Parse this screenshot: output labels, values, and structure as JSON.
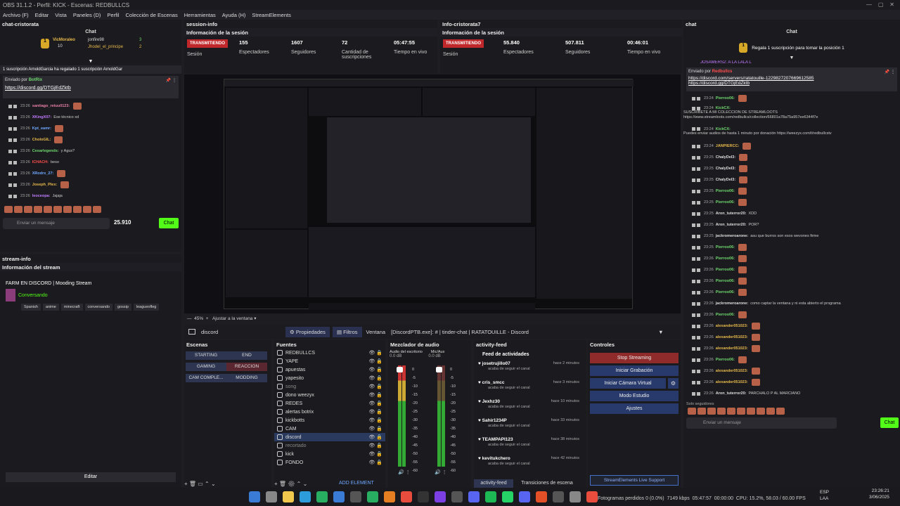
{
  "window": {
    "title": "OBS 31.1.2 - Perfil: KICK - Escenas: REDBULLCS"
  },
  "menu": [
    "Archivo (F)",
    "Editar",
    "Vista",
    "Paneles (D)",
    "Perfil",
    "Colección de Escenas",
    "Herramientas",
    "Ayuda (H)",
    "StreamElements"
  ],
  "chat_left": {
    "dock_title": "chat-cristorata",
    "tab": "Chat",
    "leader1": "VicMoraleo",
    "leader1_count": "10",
    "leader2": "jonfire98",
    "leader2_count": "3",
    "leader3": "Jhodel_el_principe",
    "leader3_count": "2",
    "banner": "1 suscripción  ArnoldGarcia ha regalado 1 suscripción  ArnoldGar",
    "pinned_by": "Enviado por",
    "pinned_user": "BotRix",
    "pinned_link": "https://discord.gg/DTGjEdZktb",
    "messages": [
      {
        "time": "23:26",
        "user": "santiago_retuu0123:",
        "text": "",
        "color": "#e67ea5"
      },
      {
        "time": "23:26",
        "user": "XKingX07:",
        "text": "Ese técnico xd",
        "color": "#c27bff"
      },
      {
        "time": "23:26",
        "user": "Kpt_eamr:",
        "text": "",
        "color": "#6fa8ff"
      },
      {
        "time": "23:26",
        "user": "CholoGIL:",
        "text": "",
        "color": "#e8b94b"
      },
      {
        "time": "23:26",
        "user": "Cesarlegends:",
        "text": "y Agus?",
        "color": "#6fd86f"
      },
      {
        "time": "23:26",
        "user": "ICHACH:",
        "text": "beso",
        "color": "#ff4d4d"
      },
      {
        "time": "23:26",
        "user": "XRodrx_27:",
        "text": "",
        "color": "#6fa8ff"
      },
      {
        "time": "23:26",
        "user": "Joseph_Plex:",
        "text": "",
        "color": "#e8b94b"
      },
      {
        "time": "23:26",
        "user": "leoceopa:",
        "text": "Jajaja",
        "color": "#c27bff"
      }
    ],
    "input_placeholder": "Enviar un mensaje",
    "points": "25.910",
    "send": "Chat"
  },
  "stream_info": {
    "dock_title": "stream-info",
    "section": "Información del stream",
    "title": "FARM EN DISCORD | Mooding Stream",
    "category": "Conversando",
    "tags": [
      "Spanish",
      "anime",
      "minecraft",
      "conversando",
      "gossip",
      "leagueofleg"
    ],
    "edit": "Editar"
  },
  "session_info": {
    "dock_title": "session-info",
    "section": "Información de la sesión",
    "status": "TRANSMITIENDO",
    "status_sub": "Sesión",
    "stats": [
      {
        "v": "155",
        "l": "Espectadores"
      },
      {
        "v": "1607",
        "l": "Seguidores"
      },
      {
        "v": "72",
        "l": "Cantidad de suscripciones"
      },
      {
        "v": "05:47:55",
        "l": "Tiempo en vivo"
      }
    ]
  },
  "info_cris": {
    "dock_title": "Info-cristorata7",
    "section": "Información de la sesión",
    "status": "TRANSMITIENDO",
    "status_sub": "Sesión",
    "stats": [
      {
        "v": "55.840",
        "l": "Espectadores"
      },
      {
        "v": "507.811",
        "l": "Seguidores"
      },
      {
        "v": "00:46:01",
        "l": "Tiempo en vivo"
      }
    ]
  },
  "preview": {
    "zoom": "45%",
    "fit": "Ajustar a la ventana",
    "source_name": "discord",
    "props": "Propiedades",
    "filters": "Filtros",
    "window_label": "Ventana",
    "window_value": "[DiscordPTB.exe]: # | tinder-chat | RATATOUILLE - Discord"
  },
  "scenes": {
    "title": "Escenas",
    "items": [
      "STARTING",
      "END",
      "GAMING",
      "REACCION",
      "CAM COMPLE...",
      "MODDING"
    ]
  },
  "sources": {
    "title": "Fuentes",
    "items": [
      "REDBULLCS",
      "YAPE",
      "apuestas",
      "yapesito",
      "song",
      "dono weezyx",
      "REDES",
      "alertas botrix",
      "kickbotts",
      "CAM",
      "discord",
      "recortado",
      "kick",
      "FONDO"
    ]
  },
  "mixer": {
    "title": "Mezclador de audio",
    "ch1": "Audio del escritorio",
    "ch2": "Mic/Aux",
    "db": "0.0 dB",
    "scale": [
      "0",
      "-5",
      "-10",
      "-15",
      "-20",
      "-25",
      "-30",
      "-35",
      "-40",
      "-45",
      "-50",
      "-55",
      "-60"
    ]
  },
  "feed": {
    "dock_title": "activity-feed",
    "header": "Feed de actividades",
    "items": [
      {
        "n": "josetrujillo07",
        "t": "hace 2 minutos",
        "s": "acaba de seguir el canal"
      },
      {
        "n": "cris_smcc",
        "t": "hace 3 minutos",
        "s": "acaba de seguir el canal"
      },
      {
        "n": "Jexhz30",
        "t": "hace 10 minutos",
        "s": "acaba de seguir el canal"
      },
      {
        "n": "Sahir1234P",
        "t": "hace 33 minutos",
        "s": "acaba de seguir el canal"
      },
      {
        "n": "TEAMPAPI123",
        "t": "hace 38 minutos",
        "s": "acaba de seguir el canal"
      },
      {
        "n": "kevitukchero",
        "t": "hace 42 minutos",
        "s": "acaba de seguir el canal"
      }
    ],
    "tab1": "activity-feed",
    "tab2": "Transiciones de escena",
    "add": "ADD ELEMENT"
  },
  "controls": {
    "title": "Controles",
    "stop": "Stop Streaming",
    "rec": "Iniciar Grabación",
    "vcam": "Iniciar Cámara Virtual",
    "studio": "Modo Estudio",
    "settings": "Ajustes",
    "se": "StreamElements Live Support"
  },
  "chat_right": {
    "dock_title": "chat",
    "tab": "Chat",
    "gift": "Regala 1 suscripción para tomar la posición 1",
    "banner": "JOSAMERS2: A LA LALA L",
    "pinned_by": "Enviado por",
    "pinned_user": "Redbullcs",
    "link1": "https://discord.com/servers/ratatouille-1229827207669612585",
    "link2": "https://discord.gg/DTGjEdZktb",
    "messages": [
      {
        "time": "23:24",
        "user": "Pierroo06:",
        "text": "",
        "color": "#6fd86f"
      },
      {
        "time": "23:24",
        "user": "KickCX:",
        "text": "SUSCRIBETE A MI COLECCION DE STREAMLOOTS https://www.streamloots.com/redbullcs/collection/66801a78a75a957ee6344f7e",
        "color": "#6fd86f"
      },
      {
        "time": "23:24",
        "user": "KickCX:",
        "text": "Puedes enviar audios de hasta 1 minuto por donación https://weezyx.com/t/redbullcstv",
        "color": "#6fd86f"
      },
      {
        "time": "23:24",
        "user": "JANPIERCC:",
        "text": "",
        "color": "#e8b94b"
      },
      {
        "time": "23:25",
        "user": "ChalyDel3:",
        "text": "",
        "color": "#ddd"
      },
      {
        "time": "23:25",
        "user": "ChalyDel3:",
        "text": "",
        "color": "#ddd"
      },
      {
        "time": "23:25",
        "user": "ChalyDel3:",
        "text": "",
        "color": "#ddd"
      },
      {
        "time": "23:25",
        "user": "Pierroo06:",
        "text": "",
        "color": "#6fd86f"
      },
      {
        "time": "23:25",
        "user": "Pierroo06:",
        "text": "",
        "color": "#6fd86f"
      },
      {
        "time": "23:25",
        "user": "Aron_tuterror20:",
        "text": "XDD",
        "color": "#ddd"
      },
      {
        "time": "23:25",
        "user": "Aron_tuterror20:",
        "text": "POR?",
        "color": "#ddd"
      },
      {
        "time": "23:25",
        "user": "jackromeroarone:",
        "text": "asu que burros son esos wevones firme",
        "color": "#ddd"
      },
      {
        "time": "23:25",
        "user": "Pierroo06:",
        "text": "",
        "color": "#6fd86f"
      },
      {
        "time": "23:26",
        "user": "Pierroo06:",
        "text": "",
        "color": "#6fd86f"
      },
      {
        "time": "23:26",
        "user": "Pierroo06:",
        "text": "",
        "color": "#6fd86f"
      },
      {
        "time": "23:26",
        "user": "Pierroo06:",
        "text": "",
        "color": "#6fd86f"
      },
      {
        "time": "23:26",
        "user": "Pierroo06:",
        "text": "",
        "color": "#6fd86f"
      },
      {
        "time": "23:26",
        "user": "jackromeroarone:",
        "text": "como captar la ventana y ni esta abierto el programa",
        "color": "#ddd"
      },
      {
        "time": "23:26",
        "user": "Pierroo06:",
        "text": "",
        "color": "#6fd86f"
      },
      {
        "time": "23:26",
        "user": "alexander051023:",
        "text": "",
        "color": "#e8b94b"
      },
      {
        "time": "23:26",
        "user": "alexander051023:",
        "text": "",
        "color": "#e8b94b"
      },
      {
        "time": "23:26",
        "user": "alexander051023:",
        "text": "",
        "color": "#e8b94b"
      },
      {
        "time": "23:26",
        "user": "Pierroo06:",
        "text": "",
        "color": "#6fd86f"
      },
      {
        "time": "23:26",
        "user": "alexander051023:",
        "text": "",
        "color": "#e8b94b"
      },
      {
        "time": "23:26",
        "user": "alexander051023:",
        "text": "",
        "color": "#e8b94b"
      },
      {
        "time": "23:26",
        "user": "Aron_tuterror20:",
        "text": "PARCHALO P AL MARCIANO",
        "color": "#ddd"
      }
    ],
    "followers_only": "Solo seguidores",
    "input_placeholder": "Enviar un mensaje",
    "send": "Chat"
  },
  "status_bar": {
    "frames": "Fotogramas perdidos 0 (0.0%)",
    "kbps": "7149 kbps",
    "live": "05:47:57",
    "rec": "00:00:00",
    "cpu": "CPU: 15.2%, 58.03 / 60.00 FPS"
  },
  "taskbar": {
    "lang": "ESP",
    "lang2": "LAA",
    "time": "23:26:21",
    "date": "3/06/2025"
  }
}
